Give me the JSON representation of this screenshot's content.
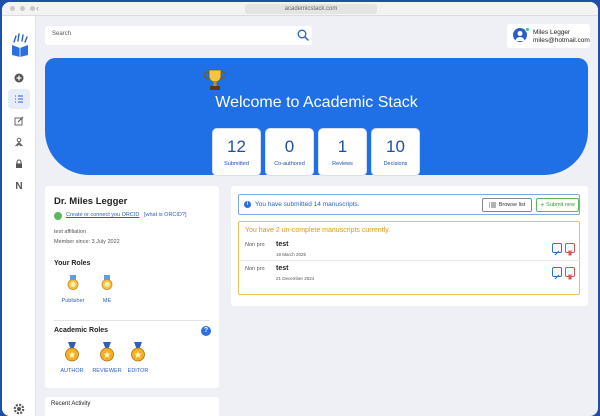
{
  "browser": {
    "url": "academicstack.com"
  },
  "search": {
    "label": "Search"
  },
  "user": {
    "name": "Miles Legger",
    "email": "miles@hotmail.com"
  },
  "hero": {
    "title": "Welcome to Academic Stack"
  },
  "stats": [
    {
      "value": "12",
      "label": "Submitted"
    },
    {
      "value": "0",
      "label": "Co-authored"
    },
    {
      "value": "1",
      "label": "Reviews"
    },
    {
      "value": "10",
      "label": "Decisions"
    }
  ],
  "profile": {
    "name": "Dr. Miles Legger",
    "orcid_link": "Create or connect you ORCID",
    "orcid_what": "[what is ORCID?]",
    "affiliation": "test affiliation",
    "member_since": "Member since: 3 July 2022",
    "roles_title": "Your Roles",
    "roles": [
      "Publisher",
      "ME"
    ],
    "academic_roles_title": "Academic Roles",
    "academic_roles": [
      "AUTHOR",
      "REVIEWER",
      "EDITOR"
    ]
  },
  "recent": {
    "title": "Recent Activity"
  },
  "manuscripts": {
    "info_text": "You have submitted 14 manuscripts.",
    "browse_label": "Browse list",
    "submit_label": "Submit new",
    "warning_text": "You have 2 un-complete manuscripts currently.",
    "items": [
      {
        "type": "Non pro",
        "title": "test",
        "date": "18 March 2025"
      },
      {
        "type": "Non pro",
        "title": "test",
        "date": "21 December 2024"
      }
    ]
  },
  "colors": {
    "primary": "#1f6fe6",
    "frame": "#1f4fa8",
    "success": "#5cb85c",
    "warning": "#e09a1a",
    "danger": "#e05050"
  },
  "icons": [
    "logo-icon",
    "add-icon",
    "list-icon",
    "edit-icon",
    "people-icon",
    "lock-icon",
    "n-icon",
    "settings-icon",
    "search-icon",
    "trophy-icon",
    "medal-icon"
  ]
}
